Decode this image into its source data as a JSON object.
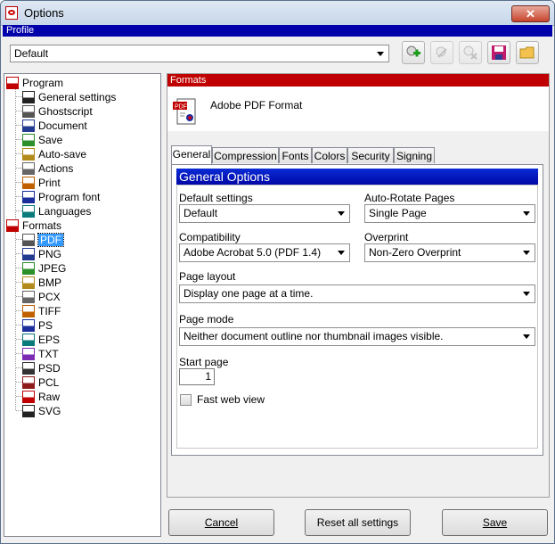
{
  "window": {
    "title": "Options",
    "close_glyph": "✕"
  },
  "profile": {
    "header": "Profile",
    "selected": "Default",
    "toolbar_icons": [
      "add-profile-icon",
      "rename-profile-icon",
      "delete-profile-icon",
      "save-profile-icon",
      "load-profile-icon"
    ]
  },
  "tree": {
    "program": {
      "label": "Program",
      "items": [
        "General settings",
        "Ghostscript",
        "Document",
        "Save",
        "Auto-save",
        "Actions",
        "Print",
        "Program font",
        "Languages"
      ]
    },
    "formats": {
      "label": "Formats",
      "items": [
        "PDF",
        "PNG",
        "JPEG",
        "BMP",
        "PCX",
        "TIFF",
        "PS",
        "EPS",
        "TXT",
        "PSD",
        "PCL",
        "Raw",
        "SVG"
      ],
      "selected": "PDF"
    }
  },
  "panel": {
    "header": "Formats",
    "format_name": "Adobe PDF Format",
    "tabs": [
      "General",
      "Compression",
      "Fonts",
      "Colors",
      "Security",
      "Signing"
    ],
    "active_tab": "General",
    "group_title": "General Options",
    "fields": {
      "default_settings": {
        "label": "Default settings",
        "value": "Default"
      },
      "auto_rotate": {
        "label": "Auto-Rotate Pages",
        "value": "Single Page"
      },
      "compatibility": {
        "label": "Compatibility",
        "value": "Adobe Acrobat 5.0 (PDF 1.4)"
      },
      "overprint": {
        "label": "Overprint",
        "value": "Non-Zero Overprint"
      },
      "page_layout": {
        "label": "Page layout",
        "value": "Display one page at a time."
      },
      "page_mode": {
        "label": "Page mode",
        "value": "Neither document outline nor thumbnail images visible."
      },
      "start_page": {
        "label": "Start page",
        "value": "1"
      },
      "fast_web_view": {
        "label": "Fast web view",
        "checked": false
      }
    }
  },
  "buttons": {
    "cancel": "Cancel",
    "reset": "Reset all settings",
    "save": "Save"
  },
  "colors": {
    "profile_bar": "#0000aa",
    "formats_bar": "#c00000",
    "group_header": "#0a2bd6",
    "selection": "#3399ff"
  }
}
